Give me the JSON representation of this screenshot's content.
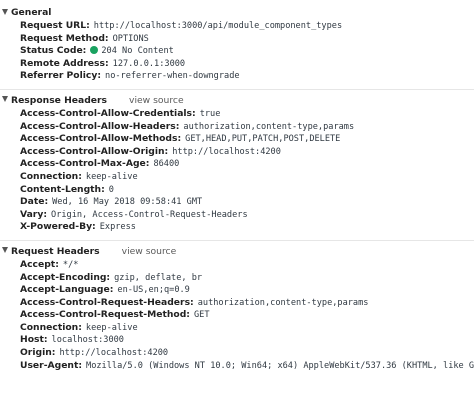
{
  "general": {
    "title": "General",
    "rows": [
      {
        "key": "Request URL:",
        "value": "http://localhost:3000/api/module_component_types"
      },
      {
        "key": "Request Method:",
        "value": "OPTIONS"
      },
      {
        "key": "Status Code:",
        "value": "204 No Content",
        "status_color": "#1aa260"
      },
      {
        "key": "Remote Address:",
        "value": "127.0.0.1:3000"
      },
      {
        "key": "Referrer Policy:",
        "value": "no-referrer-when-downgrade"
      }
    ]
  },
  "response_headers": {
    "title": "Response Headers",
    "view_source": "view source",
    "rows": [
      {
        "key": "Access-Control-Allow-Credentials:",
        "value": "true"
      },
      {
        "key": "Access-Control-Allow-Headers:",
        "value": "authorization,content-type,params"
      },
      {
        "key": "Access-Control-Allow-Methods:",
        "value": "GET,HEAD,PUT,PATCH,POST,DELETE"
      },
      {
        "key": "Access-Control-Allow-Origin:",
        "value": "http://localhost:4200"
      },
      {
        "key": "Access-Control-Max-Age:",
        "value": "86400"
      },
      {
        "key": "Connection:",
        "value": "keep-alive"
      },
      {
        "key": "Content-Length:",
        "value": "0"
      },
      {
        "key": "Date:",
        "value": "Wed, 16 May 2018 09:58:41 GMT"
      },
      {
        "key": "Vary:",
        "value": "Origin, Access-Control-Request-Headers"
      },
      {
        "key": "X-Powered-By:",
        "value": "Express"
      }
    ]
  },
  "request_headers": {
    "title": "Request Headers",
    "view_source": "view source",
    "rows": [
      {
        "key": "Accept:",
        "value": "*/*"
      },
      {
        "key": "Accept-Encoding:",
        "value": "gzip, deflate, br"
      },
      {
        "key": "Accept-Language:",
        "value": "en-US,en;q=0.9"
      },
      {
        "key": "Access-Control-Request-Headers:",
        "value": "authorization,content-type,params"
      },
      {
        "key": "Access-Control-Request-Method:",
        "value": "GET"
      },
      {
        "key": "Connection:",
        "value": "keep-alive"
      },
      {
        "key": "Host:",
        "value": "localhost:3000"
      },
      {
        "key": "Origin:",
        "value": "http://localhost:4200"
      },
      {
        "key": "User-Agent:",
        "value": "Mozilla/5.0 (Windows NT 10.0; Win64; x64) AppleWebKit/537.36 (KHTML, like G"
      }
    ]
  }
}
